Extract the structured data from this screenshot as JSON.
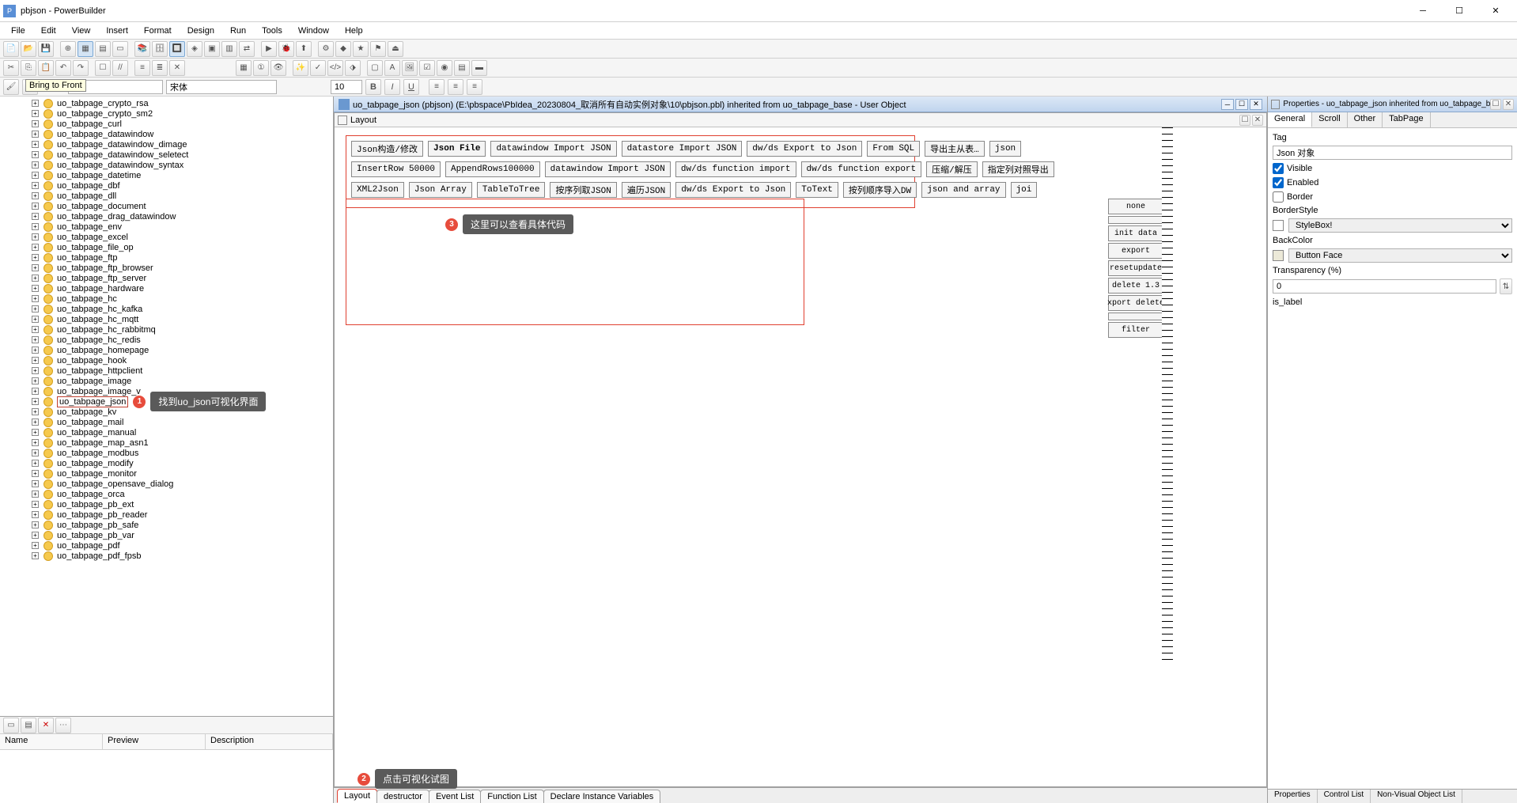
{
  "title": "pbjson - PowerBuilder",
  "menus": [
    "File",
    "Edit",
    "View",
    "Insert",
    "Format",
    "Design",
    "Run",
    "Tools",
    "Window",
    "Help"
  ],
  "tooltip": "Bring to Front",
  "fmt": {
    "font": "宋体",
    "size": "10"
  },
  "doc_title": "uo_tabpage_json (pbjson) (E:\\pbspace\\PbIdea_20230804_取消所有自动实例对象\\10\\pbjson.pbl) inherited from uo_tabpage_base - User Object",
  "layout_label": "Layout",
  "tree": [
    "uo_tabpage_crypto_rsa",
    "uo_tabpage_crypto_sm2",
    "uo_tabpage_curl",
    "uo_tabpage_datawindow",
    "uo_tabpage_datawindow_dimage",
    "uo_tabpage_datawindow_seletect",
    "uo_tabpage_datawindow_syntax",
    "uo_tabpage_datetime",
    "uo_tabpage_dbf",
    "uo_tabpage_dll",
    "uo_tabpage_document",
    "uo_tabpage_drag_datawindow",
    "uo_tabpage_env",
    "uo_tabpage_excel",
    "uo_tabpage_file_op",
    "uo_tabpage_ftp",
    "uo_tabpage_ftp_browser",
    "uo_tabpage_ftp_server",
    "uo_tabpage_hardware",
    "uo_tabpage_hc",
    "uo_tabpage_hc_kafka",
    "uo_tabpage_hc_mqtt",
    "uo_tabpage_hc_rabbitmq",
    "uo_tabpage_hc_redis",
    "uo_tabpage_homepage",
    "uo_tabpage_hook",
    "uo_tabpage_httpclient",
    "uo_tabpage_image",
    "uo_tabpage_image_v",
    "uo_tabpage_json",
    "uo_tabpage_kv",
    "uo_tabpage_mail",
    "uo_tabpage_manual",
    "uo_tabpage_map_asn1",
    "uo_tabpage_modbus",
    "uo_tabpage_modify",
    "uo_tabpage_monitor",
    "uo_tabpage_opensave_dialog",
    "uo_tabpage_orca",
    "uo_tabpage_pb_ext",
    "uo_tabpage_pb_reader",
    "uo_tabpage_pb_safe",
    "uo_tabpage_pb_var",
    "uo_tabpage_pdf",
    "uo_tabpage_pdf_fpsb"
  ],
  "tree_selected_index": 29,
  "callout1": "找到uo_json可视化界面",
  "callout2": "点击可视化试图",
  "callout3": "这里可以查看具体代码",
  "bottom_headers": [
    "Name",
    "Preview",
    "Description"
  ],
  "btn_rows": [
    [
      "Json构造/修改",
      "Json File",
      "datawindow Import JSON",
      "datastore Import JSON",
      "dw/ds Export to Json",
      "From SQL",
      "导出主从表…",
      "json"
    ],
    [
      "InsertRow 50000",
      "AppendRows100000",
      "datawindow Import JSON",
      "dw/ds function import",
      "dw/ds function export",
      "压缩/解压",
      "指定列对照导出"
    ],
    [
      "XML2Json",
      "Json Array",
      "TableToTree",
      "按序列取JSON",
      "遍历JSON",
      "dw/ds Export to Json",
      "ToText",
      "按列顺序导入DW",
      "json and array",
      "joi"
    ]
  ],
  "bold_btn": "Json File",
  "side_buttons": [
    "none",
    "",
    "init data",
    "export",
    "resetupdate",
    "delete 1.3",
    "xport delete",
    "",
    "filter"
  ],
  "editor_tabs": [
    "Layout",
    "destructor",
    "Event List",
    "Function List",
    "Declare Instance Variables"
  ],
  "props": {
    "title": "Properties - uo_tabpage_json inherited from uo_tabpage_base",
    "tabs": [
      "General",
      "Scroll",
      "Other",
      "TabPage"
    ],
    "tag_label": "Tag",
    "tag": "Json 对象",
    "visible_label": "Visible",
    "visible": true,
    "enabled_label": "Enabled",
    "enabled": true,
    "border_label": "Border",
    "border": false,
    "borderstyle_label": "BorderStyle",
    "borderstyle": "StyleBox!",
    "backcolor_label": "BackColor",
    "backcolor": "Button Face",
    "trans_label": "Transparency (%)",
    "trans": "0",
    "islabel_label": "is_label"
  },
  "rp_bottom_tabs": [
    "Properties",
    "Control List",
    "Non-Visual Object List"
  ]
}
